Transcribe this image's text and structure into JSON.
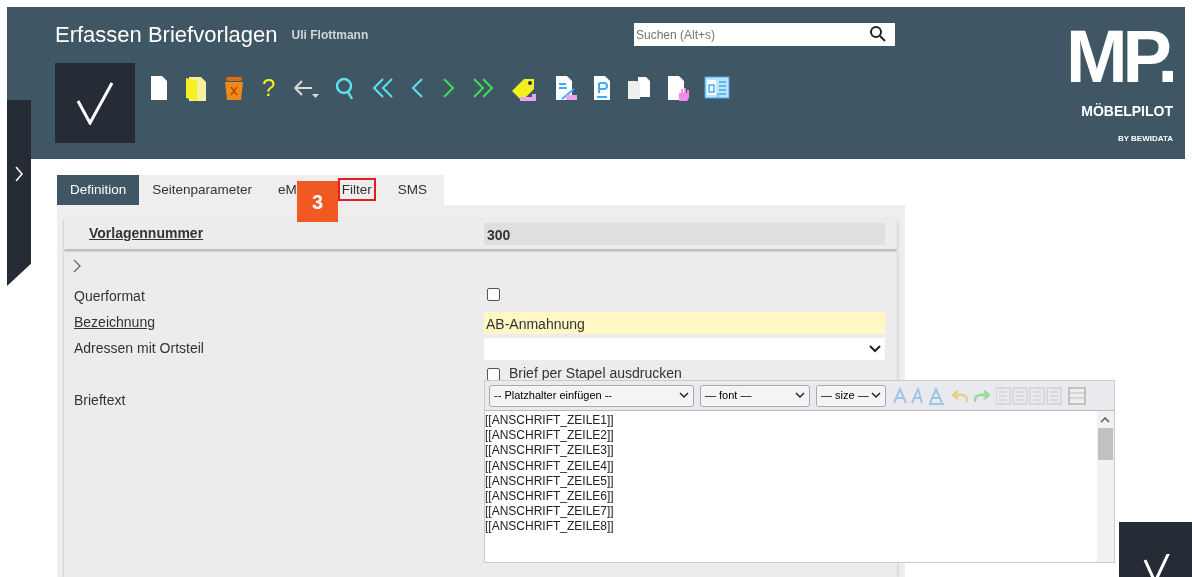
{
  "header": {
    "title": "Erfassen Briefvorlagen",
    "user": "Uli Flottmann",
    "search": {
      "placeholder": "Suchen (Alt+s)"
    },
    "help_glyph": "?"
  },
  "logo": {
    "mark": "MP.",
    "name": "MÖBELPILOT",
    "tagline": "BY BEWIDATA"
  },
  "tabs": [
    {
      "label": "Definition",
      "selected": true,
      "highlighted": false
    },
    {
      "label": "Seitenparameter",
      "selected": false,
      "highlighted": false
    },
    {
      "label": "eM",
      "selected": false,
      "highlighted": false
    },
    {
      "label": "Filter",
      "selected": false,
      "highlighted": true
    },
    {
      "label": "SMS",
      "selected": false,
      "highlighted": false
    }
  ],
  "callout": {
    "label": "3"
  },
  "key_field": {
    "label": "Vorlagennummer",
    "value": "300"
  },
  "fields": [
    {
      "kind": "checkbox",
      "label": "Querformat",
      "checked": false,
      "linked": false
    },
    {
      "kind": "text",
      "label": "Bezeichnung",
      "value": "AB-Anmahnung",
      "linked": true
    },
    {
      "kind": "select",
      "label": "Adressen mit Ortsteil",
      "linked": false
    },
    {
      "kind": "option",
      "option": "Brief per Stapel ausdrucken",
      "checked": false
    },
    {
      "kind": "editor",
      "label": "Brieftext",
      "linked": false
    }
  ],
  "editor": {
    "placeholder_select": "-- Platzhalter einfügen --",
    "font_select": "— font —",
    "size_select": "— size —",
    "lines": [
      "[[ANSCHRIFT_ZEILE1]]",
      "[[ANSCHRIFT_ZEILE2]]",
      "[[ANSCHRIFT_ZEILE3]]",
      "[[ANSCHRIFT_ZEILE4]]",
      "[[ANSCHRIFT_ZEILE5]]",
      "[[ANSCHRIFT_ZEILE6]]",
      "[[ANSCHRIFT_ZEILE7]]",
      "[[ANSCHRIFT_ZEILE8]]"
    ]
  }
}
